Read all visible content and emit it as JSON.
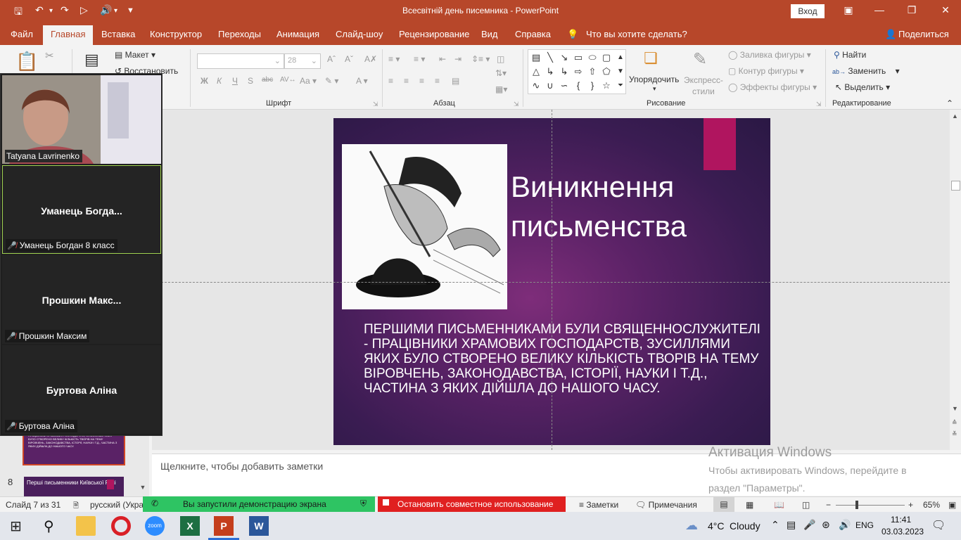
{
  "titlebar": {
    "title": "Всесвітній день писемника  -  PowerPoint",
    "signin": "Вход"
  },
  "tabs": [
    "Файл",
    "Главная",
    "Вставка",
    "Конструктор",
    "Переходы",
    "Анимация",
    "Слайд-шоу",
    "Рецензирование",
    "Вид",
    "Справка"
  ],
  "tell_me": "Что вы хотите сделать?",
  "share": "Поделиться",
  "ribbon": {
    "layout": "Макет",
    "reset": "Восстановить",
    "font_group": "Шрифт",
    "font_size": "28",
    "para_group": "Абзац",
    "drawing_group": "Рисование",
    "arrange": "Упорядочить",
    "express_styles": "Экспресс-\nстили",
    "shape_fill": "Заливка фигуры",
    "shape_outline": "Контур фигуры",
    "shape_effects": "Эффекты фигуры",
    "find": "Найти",
    "replace": "Заменить",
    "select": "Выделить",
    "editing_group": "Редактирование"
  },
  "participants": [
    {
      "name": "Tatyana Lavrinenko",
      "video": true
    },
    {
      "name": "Уманець  Богда...",
      "label": "Уманець Богдан 8 класс",
      "active": true
    },
    {
      "name": "Прошкин  Макс...",
      "label": "Прошкин Максим"
    },
    {
      "name": "Буртова Аліна",
      "label": "Буртова Аліна"
    }
  ],
  "thumbnail": {
    "slide8_num": "8",
    "slide8_title": "Перші письменники Київської Русі",
    "slide7_text": "ПЕРШИМИ ПИСЬМЕННИКАМИ БУЛИ СВЯЩЕННОСЛУЖИТЕЛІ - ПРАЦІВНИКИ ХРАМОВИХ ГОСПОДАРСТВ, ЗУСИЛЛЯМИ ЯКИХ БУЛО СТВОРЕНО ВЕЛИКУ КІЛЬКІСТЬ ТВОРІВ НА ТЕМУ ВІРОВЧЕНЬ, ЗАКОНОДАВСТВА, ІСТОРІЇ, НАУКИ І Т.Д., ЧАСТИНА З ЯКИХ ДІЙШЛА ДО НАШОГО ЧАСУ."
  },
  "slide": {
    "title_line1": "Виникнення",
    "title_line2": "письменства",
    "body": "Першими письменниками були священнослужителі - працівники храмових господарств, зусиллями яких було створено велику кількість творів на тему віровчень, законодавства, історії, науки і т.д., частина з яких дійшла до нашого часу."
  },
  "notes_placeholder": "Щелкните, чтобы добавить заметки",
  "activation": {
    "heading": "Активация Windows",
    "line1": "Чтобы активировать Windows, перейдите в",
    "line2": "раздел \"Параметры\"."
  },
  "status": {
    "slide_info": "Слайд 7 из 31",
    "language": "русский (Укра",
    "sharing": "Вы запустили демонстрацию экрана",
    "stop_sharing": "Остановить совместное использование",
    "notes": "Заметки",
    "comments": "Примечания",
    "zoom": "65%"
  },
  "taskbar": {
    "weather_temp": "4°C",
    "weather_desc": "Cloudy",
    "lang": "ENG",
    "time": "11:41",
    "date": "03.03.2023"
  }
}
